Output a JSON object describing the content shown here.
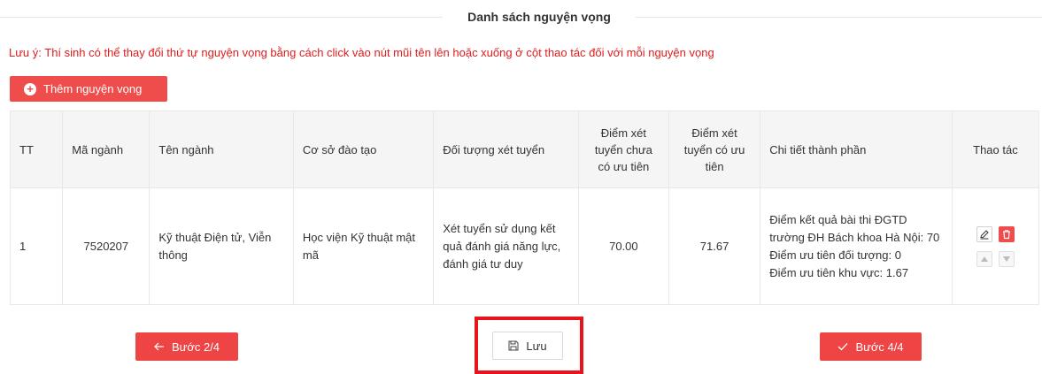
{
  "section_title": "Danh sách nguyện vọng",
  "note": "Lưu ý: Thí sinh có thể thay đổi thứ tự nguyện vọng bằng cách click vào nút mũi tên lên hoặc xuống ở cột thao tác đối với mỗi nguyện vọng",
  "add_button_label": "Thêm nguyện vọng",
  "table": {
    "headers": {
      "tt": "TT",
      "ma_nganh": "Mã ngành",
      "ten_nganh": "Tên ngành",
      "co_so": "Cơ sở đào tạo",
      "doi_tuong": "Đối tượng xét tuyển",
      "diem_chua_uu_tien": "Điểm xét tuyển chưa có ưu tiên",
      "diem_co_uu_tien": "Điểm xét tuyển có ưu tiên",
      "chi_tiet": "Chi tiết thành phần",
      "thao_tac": "Thao tác"
    },
    "rows": [
      {
        "tt": "1",
        "ma_nganh": "7520207",
        "ten_nganh": "Kỹ thuật Điện tử, Viễn thông",
        "co_so": "Học viện Kỹ thuật mật mã",
        "doi_tuong": "Xét tuyển sử dụng kết quả đánh giá năng lực, đánh giá tư duy",
        "diem_chua_uu_tien": "70.00",
        "diem_co_uu_tien": "71.67",
        "chi_tiet": {
          "line1": "Điểm kết quả bài thi ĐGTD trường ĐH Bách khoa Hà Nội: 70",
          "line2": "Điểm ưu tiên đối tượng: 0",
          "line3": "Điểm ưu tiên khu vực: 1.67"
        }
      }
    ]
  },
  "buttons": {
    "prev": "Bước 2/4",
    "save": "Lưu",
    "next": "Bước 4/4"
  },
  "icons": {
    "add": "plus-circle-icon",
    "edit": "pencil-icon",
    "delete": "trash-icon",
    "up": "arrow-up-icon",
    "down": "arrow-down-icon",
    "prev": "arrow-left-icon",
    "save": "floppy-disk-icon",
    "next": "check-icon"
  },
  "colors": {
    "accent_red": "#ef4c4c",
    "note_red": "#e01c1c",
    "highlight_red": "#e8141b"
  }
}
